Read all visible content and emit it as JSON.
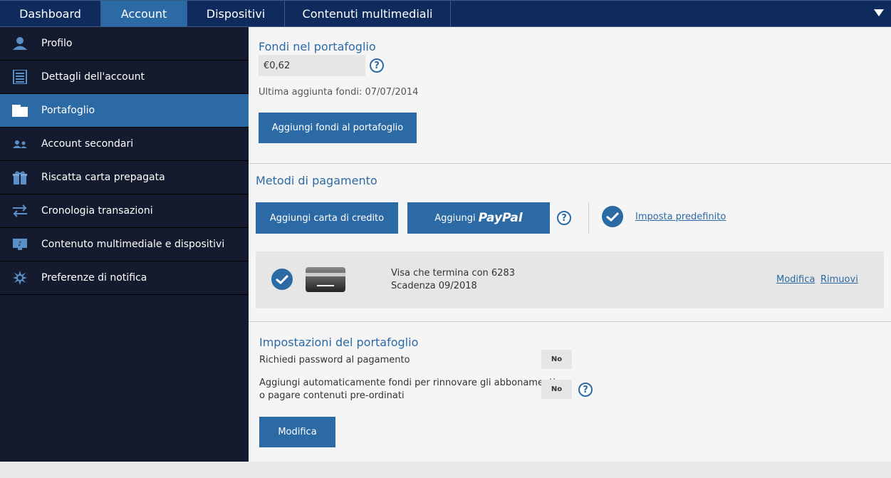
{
  "topnav": {
    "tabs": [
      {
        "label": "Dashboard"
      },
      {
        "label": "Account"
      },
      {
        "label": "Dispositivi"
      },
      {
        "label": "Contenuti multimediali"
      }
    ]
  },
  "sidebar": {
    "items": [
      {
        "label": "Profilo",
        "icon": "user-icon"
      },
      {
        "label": "Dettagli dell'account",
        "icon": "document-icon"
      },
      {
        "label": "Portafoglio",
        "icon": "wallet-icon"
      },
      {
        "label": "Account secondari",
        "icon": "users-icon"
      },
      {
        "label": "Riscatta carta prepagata",
        "icon": "gift-icon"
      },
      {
        "label": "Cronologia transazioni",
        "icon": "transfer-icon"
      },
      {
        "label": "Contenuto multimediale e dispositivi",
        "icon": "media-icon"
      },
      {
        "label": "Preferenze di notifica",
        "icon": "notification-icon"
      }
    ]
  },
  "wallet": {
    "title": "Fondi nel portafoglio",
    "balance": "€0,62",
    "last_added": "Ultima aggiunta fondi: 07/07/2014",
    "add_funds_button": "Aggiungi fondi al portafoglio"
  },
  "payment": {
    "title": "Metodi di pagamento",
    "add_card_button": "Aggiungi carta di credito",
    "add_paypal_prefix": "Aggiungi",
    "paypal_brand": "PayPal",
    "set_default_link": "Imposta predefinito",
    "card": {
      "line1": "Visa che termina con 6283",
      "line2": "Scadenza 09/2018",
      "edit_link": "Modifica",
      "remove_link": "Rimuovi"
    }
  },
  "settings": {
    "title": "Impostazioni del portafoglio",
    "password_label": "Richiedi password al pagamento",
    "password_value": "No",
    "autofund_label_1": "Aggiungi automaticamente fondi per rinnovare gli abbonamenti",
    "autofund_label_2": "o pagare contenuti pre-ordinati",
    "autofund_value": "No",
    "edit_button": "Modifica"
  },
  "colors": {
    "accent": "#2c6aa5",
    "nav_bg": "#0f2a5c",
    "sidebar_bg": "#141b2e"
  }
}
